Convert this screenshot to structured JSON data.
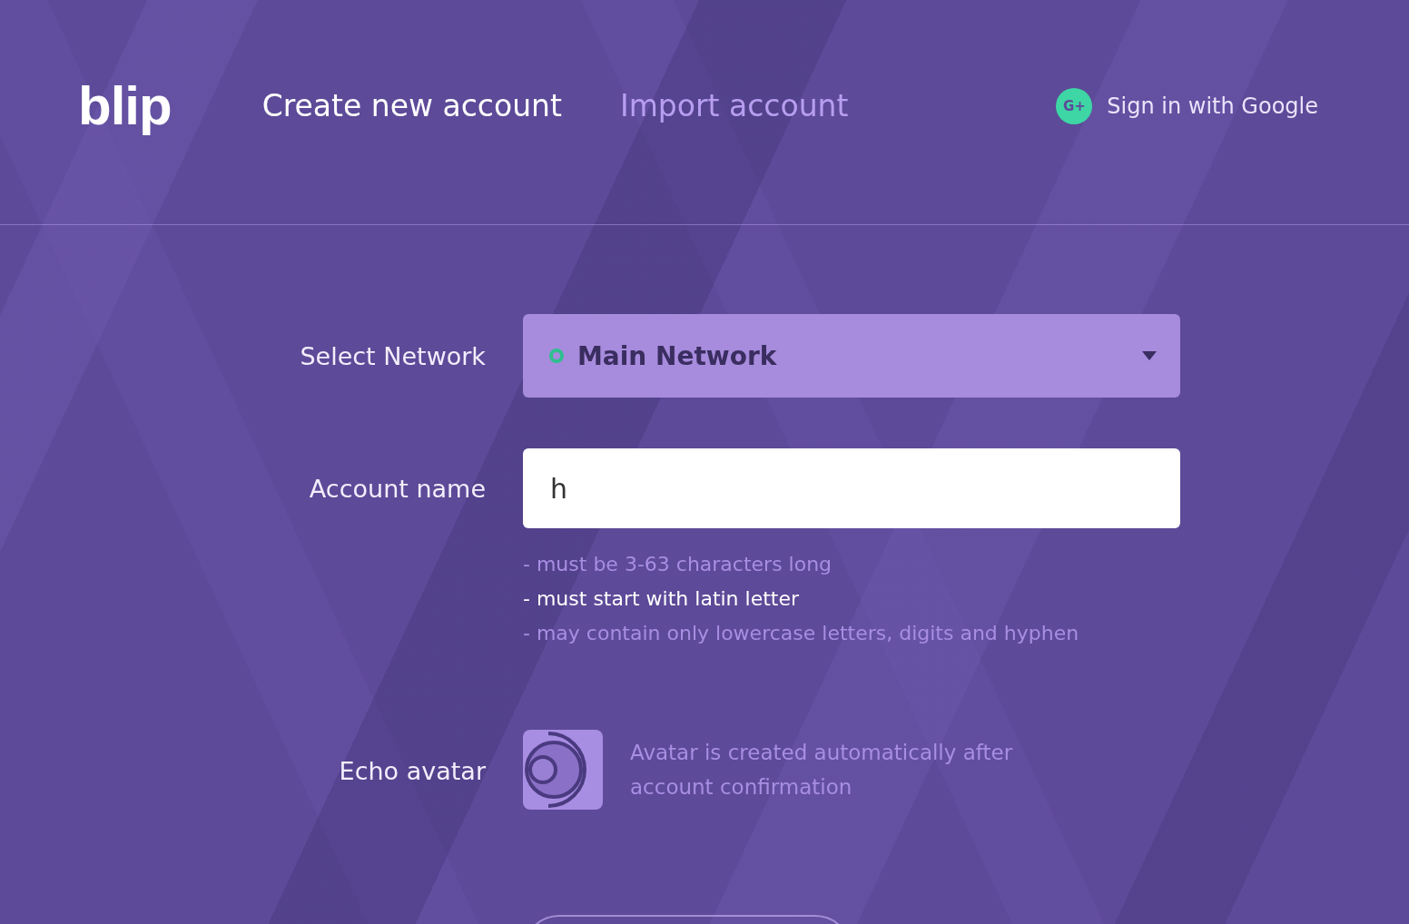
{
  "logo": "blip",
  "tabs": [
    {
      "label": "Create new account",
      "selected": true
    },
    {
      "label": "Import account",
      "selected": false
    }
  ],
  "google_signin": {
    "label": "Sign in with Google",
    "icon_text": "G+"
  },
  "network": {
    "label": "Select Network",
    "value": "Main Network"
  },
  "account_name": {
    "label": "Account name",
    "value": "h"
  },
  "requirements": [
    {
      "text": "- must be 3-63 characters long",
      "highlighted": false
    },
    {
      "text": "- must start with latin letter",
      "highlighted": true
    },
    {
      "text": "- may contain only lowercase letters, digits and hyphen",
      "highlighted": false
    }
  ],
  "avatar": {
    "label": "Echo avatar",
    "note": "Avatar is created automatically after account confirmation"
  }
}
